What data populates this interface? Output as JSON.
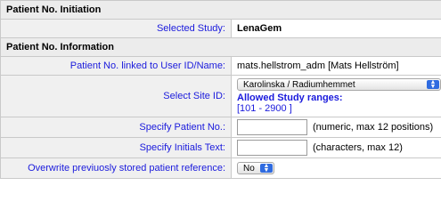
{
  "sections": {
    "initiation_title": "Patient No. Initiation",
    "information_title": "Patient No. Information"
  },
  "rows": {
    "selected_study": {
      "label": "Selected Study:",
      "value": "LenaGem"
    },
    "linked_user": {
      "label": "Patient No. linked to User ID/Name:",
      "value": "mats.hellstrom_adm [Mats Hellström]"
    },
    "site": {
      "label": "Select Site ID:",
      "selected": "Karolinska / Radiumhemmet",
      "ranges_label": "Allowed Study ranges:",
      "ranges_value": "[101 - 2900 ]"
    },
    "patient_no": {
      "label": "Specify Patient No.:",
      "value": "",
      "hint": "(numeric, max 12 positions)"
    },
    "initials": {
      "label": "Specify Initials Text:",
      "value": "",
      "hint": "(characters, max 12)"
    },
    "overwrite": {
      "label": "Overwrite previuosly stored patient reference:",
      "selected": "No"
    }
  },
  "icons": {
    "select_arrows": "up-down-arrows-icon"
  },
  "colors": {
    "label_text": "#1a1adc",
    "section_bg": "#ececec",
    "label_bg": "#f0f0f0",
    "select_arrow": "#2f6be0"
  }
}
